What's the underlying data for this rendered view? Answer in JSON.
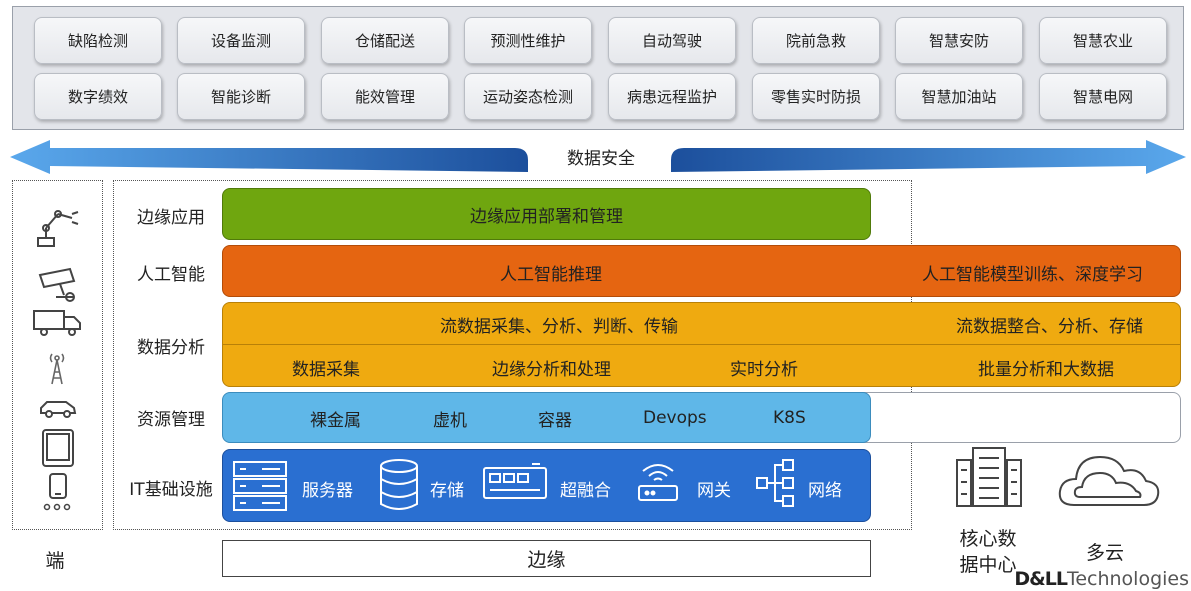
{
  "applications": [
    [
      "缺陷检测",
      "设备监测",
      "仓储配送",
      "预测性维护",
      "自动驾驶",
      "院前急救",
      "智慧安防",
      "智慧农业"
    ],
    [
      "数字绩效",
      "智能诊断",
      "能效管理",
      "运动姿态检测",
      "病患远程监护",
      "零售实时防损",
      "智慧加油站",
      "智慧电网"
    ]
  ],
  "security_label": "数据安全",
  "row_labels": {
    "edge_app": "边缘应用",
    "ai": "人工智能",
    "data": "数据分析",
    "resource": "资源管理",
    "it": "IT基础设施"
  },
  "bars": {
    "edge_app": "边缘应用部署和管理",
    "ai_edge": "人工智能推理",
    "ai_core": "人工智能模型训练、深度学习",
    "stream_edge": "流数据采集、分析、判断、传输",
    "stream_core": "流数据整合、分析、存储",
    "data_collect": "数据采集",
    "edge_analysis": "边缘分析和处理",
    "realtime": "实时分析",
    "batch": "批量分析和大数据",
    "baremetal": "裸金属",
    "vm": "虚机",
    "container": "容器",
    "devops": "Devops",
    "k8s": "K8S"
  },
  "it_items": {
    "server": "服务器",
    "storage": "存储",
    "hci": "超融合",
    "gateway": "网关",
    "network": "网络"
  },
  "bottom": {
    "device": "端",
    "edge": "边缘",
    "core_line1": "核心数",
    "core_line2": "据中心",
    "cloud": "多云"
  },
  "brand": {
    "bold": "D&LL",
    "rest": "Technologies"
  },
  "colors": {
    "edge_app": "#6fa60f",
    "ai": "#e56511",
    "data": "#efaa10",
    "resource": "#5fb7e8",
    "it": "#2a6fd1",
    "arrow_left": "#3a8fd9",
    "arrow_right": "#1c4f9c"
  }
}
